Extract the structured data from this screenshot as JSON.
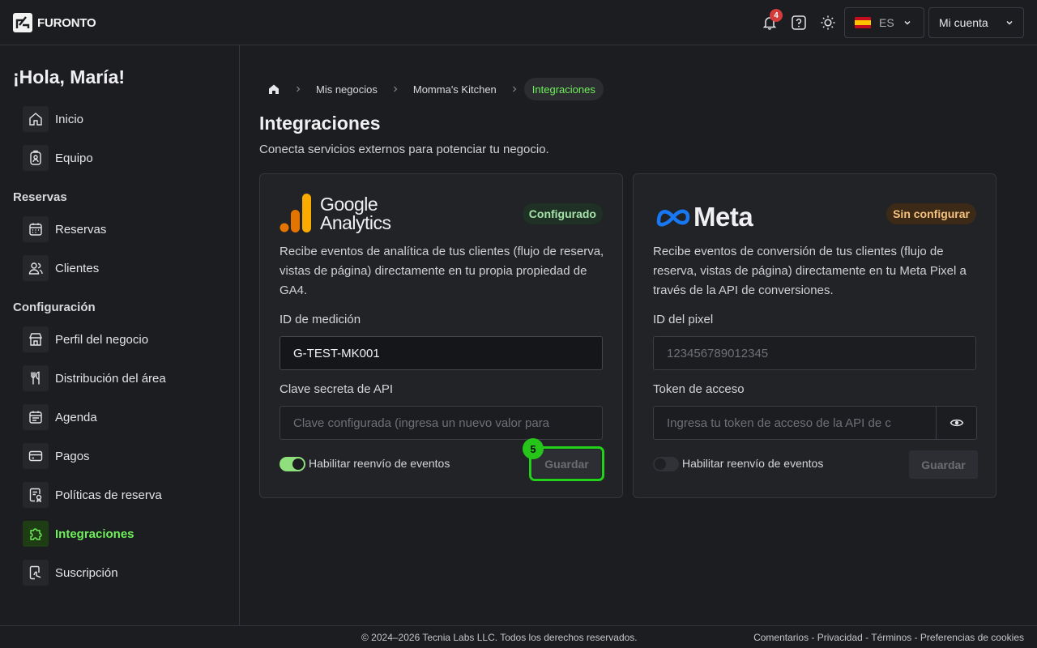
{
  "header": {
    "brand": "FURONTO",
    "notifications_count": "4",
    "language": "ES",
    "account_label": "Mi cuenta"
  },
  "sidebar": {
    "greeting": "¡Hola, María!",
    "items": [
      {
        "label": "Inicio",
        "icon": "home-icon"
      },
      {
        "label": "Equipo",
        "icon": "id-badge-icon"
      },
      {
        "label": "Reservas",
        "icon": "calendar-icon"
      },
      {
        "label": "Clientes",
        "icon": "users-icon"
      },
      {
        "label": "Perfil del negocio",
        "icon": "store-icon"
      },
      {
        "label": "Distribución del área",
        "icon": "utensils-icon"
      },
      {
        "label": "Agenda",
        "icon": "schedule-icon"
      },
      {
        "label": "Pagos",
        "icon": "card-icon"
      },
      {
        "label": "Políticas de reserva",
        "icon": "policy-icon"
      },
      {
        "label": "Integraciones",
        "icon": "puzzle-icon",
        "active": true
      },
      {
        "label": "Suscripción",
        "icon": "subscription-icon"
      }
    ],
    "sections": [
      "Reservas",
      "Configuración"
    ]
  },
  "breadcrumb": {
    "items": [
      "Mis negocios",
      "Momma's Kitchen",
      "Integraciones"
    ]
  },
  "page": {
    "title": "Integraciones",
    "subtitle": "Conecta servicios externos para potenciar tu negocio."
  },
  "google": {
    "logo_line1": "Google",
    "logo_line2": "Analytics",
    "status": "Configurado",
    "description": "Recibe eventos de analítica de tus clientes (flujo de reserva, vistas de página) directamente en tu propia propiedad de GA4.",
    "id_label": "ID de medición",
    "id_value": "G-TEST-MK001",
    "secret_label": "Clave secreta de API",
    "secret_placeholder": "Clave configurada (ingresa un nuevo valor para",
    "toggle_label": "Habilitar reenvío de eventos",
    "toggle_on": true,
    "save_label": "Guardar",
    "step_marker": "5"
  },
  "meta": {
    "logo_text": "Meta",
    "status": "Sin configurar",
    "description": "Recibe eventos de conversión de tus clientes (flujo de reserva, vistas de página) directamente en tu Meta Pixel a través de la API de conversiones.",
    "pixel_label": "ID del pixel",
    "pixel_placeholder": "123456789012345",
    "token_label": "Token de acceso",
    "token_placeholder": "Ingresa tu token de acceso de la API de c",
    "toggle_label": "Habilitar reenvío de eventos",
    "toggle_on": false,
    "save_label": "Guardar"
  },
  "footer": {
    "copyright": "© 2024–2026 Tecnia Labs LLC. Todos los derechos reservados.",
    "links": "Comentarios - Privacidad - Términos - Preferencias de cookies"
  },
  "colors": {
    "accent": "#6ff05a",
    "background": "#1c1d20",
    "status_ok": "#a4e3a9",
    "status_warn": "#f6c27e"
  }
}
